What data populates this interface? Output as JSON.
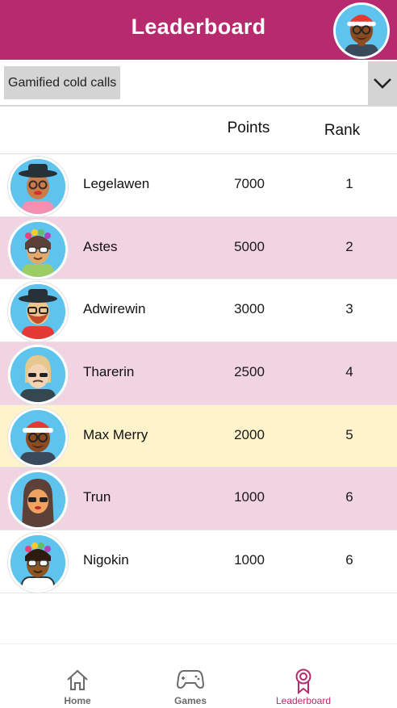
{
  "header": {
    "title": "Leaderboard"
  },
  "filter": {
    "selected": "Gamified cold calls"
  },
  "columns": {
    "points": "Points",
    "rank": "Rank"
  },
  "rows": [
    {
      "name": "Legelawen",
      "points": "7000",
      "rank": "1",
      "avatar": "avatar-hat-lipstick",
      "highlight": "none"
    },
    {
      "name": "Astes",
      "points": "5000",
      "rank": "2",
      "avatar": "avatar-flower-sunglasses",
      "highlight": "pink"
    },
    {
      "name": "Adwirewin",
      "points": "3000",
      "rank": "3",
      "avatar": "avatar-hat-beard",
      "highlight": "none"
    },
    {
      "name": "Tharerin",
      "points": "2500",
      "rank": "4",
      "avatar": "avatar-blonde-sunglasses",
      "highlight": "pink"
    },
    {
      "name": "Max Merry",
      "points": "2000",
      "rank": "5",
      "avatar": "avatar-santa-hat",
      "highlight": "self"
    },
    {
      "name": "Trun",
      "points": "1000",
      "rank": "6",
      "avatar": "avatar-longhair-sunglasses",
      "highlight": "pink"
    },
    {
      "name": "Nigokin",
      "points": "1000",
      "rank": "6",
      "avatar": "avatar-flower-sunglasses",
      "highlight": "none"
    }
  ],
  "nav": [
    {
      "label": "Home",
      "icon": "home-icon",
      "active": false
    },
    {
      "label": "Games",
      "icon": "gamepad-icon",
      "active": false
    },
    {
      "label": "Leaderboard",
      "icon": "award-ribbon-icon",
      "active": true
    }
  ],
  "colors": {
    "brand": "#b72a6d",
    "row_pink": "#f1d3e2",
    "row_self": "#fff3cc"
  }
}
